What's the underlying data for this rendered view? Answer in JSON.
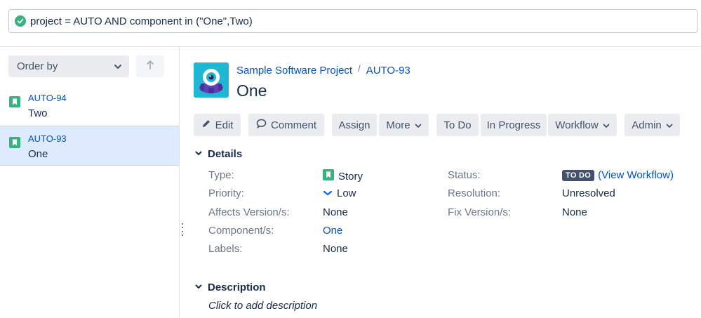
{
  "jql": {
    "query": "project = AUTO AND component in (\"One\",Two)",
    "status_color": "#36b37e"
  },
  "sidebar": {
    "order_by_label": "Order by",
    "issues": [
      {
        "key": "AUTO-94",
        "summary": "Two",
        "type_icon": "story-icon",
        "selected": false
      },
      {
        "key": "AUTO-93",
        "summary": "One",
        "type_icon": "story-icon",
        "selected": true
      }
    ]
  },
  "issue": {
    "project_name": "Sample Software Project",
    "key": "AUTO-93",
    "summary": "One",
    "toolbar": {
      "edit": "Edit",
      "comment": "Comment",
      "assign": "Assign",
      "more": "More",
      "to_do": "To Do",
      "in_progress": "In Progress",
      "workflow": "Workflow",
      "admin": "Admin"
    },
    "details": {
      "heading": "Details",
      "type_label": "Type:",
      "type_value": "Story",
      "priority_label": "Priority:",
      "priority_value": "Low",
      "affects_label": "Affects Version/s:",
      "affects_value": "None",
      "component_label": "Component/s:",
      "component_value": "One",
      "labels_label": "Labels:",
      "labels_value": "None",
      "status_label": "Status:",
      "status_value": "TO DO",
      "view_workflow_prefix": "(",
      "view_workflow": "View Workflow",
      "view_workflow_suffix": ")",
      "resolution_label": "Resolution:",
      "resolution_value": "Unresolved",
      "fix_label": "Fix Version/s:",
      "fix_value": "None"
    },
    "description": {
      "heading": "Description",
      "placeholder": "Click to add description"
    }
  },
  "colors": {
    "link": "#0052cc",
    "story": "#36b37e",
    "lozenge": "#42526e",
    "selected_bg": "#deebff"
  }
}
